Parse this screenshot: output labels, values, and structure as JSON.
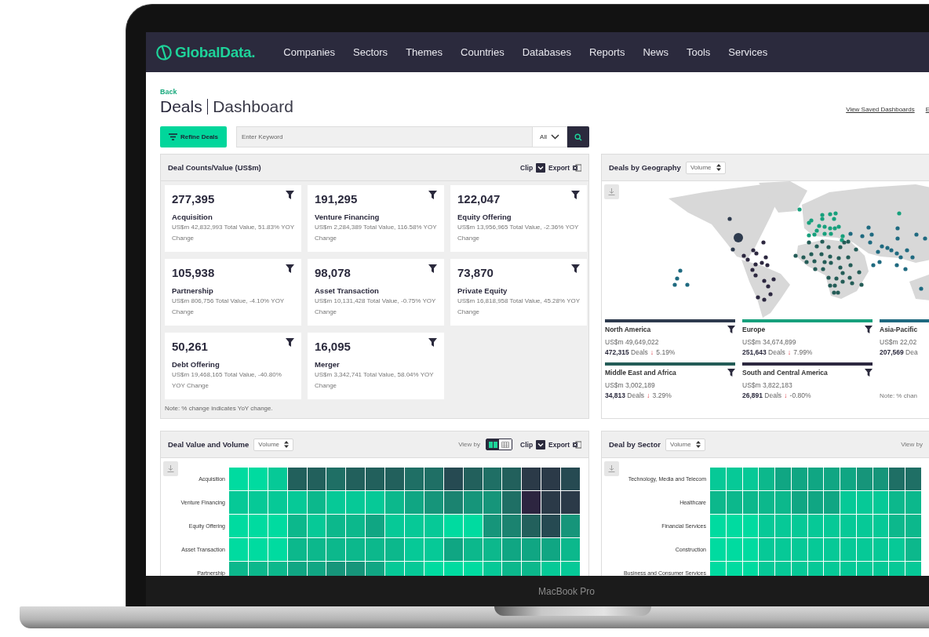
{
  "laptop": {
    "label": "MacBook Pro"
  },
  "nav": {
    "logo": "GlobalData.",
    "items": [
      "Companies",
      "Sectors",
      "Themes",
      "Countries",
      "Databases",
      "Reports",
      "News",
      "Tools",
      "Services"
    ]
  },
  "header": {
    "back": "Back",
    "title": "Deals",
    "subtitle": "Dashboard",
    "links": [
      "View Saved Dashboards",
      "E"
    ]
  },
  "toolbar": {
    "refine_button": "Refine Deals",
    "search": {
      "placeholder": "Enter Keyword"
    },
    "scope": "All"
  },
  "deal_counts": {
    "title": "Deal Counts/Value (US$m)",
    "clip": "Clip",
    "export": "Export",
    "cards": [
      {
        "count": "277,395",
        "type": "Acquisition",
        "detail": "US$m 42,832,993 Total Value, 51.83% YOY Change"
      },
      {
        "count": "191,295",
        "type": "Venture Financing",
        "detail": "US$m 2,284,389 Total Value, 116.58% YOY Change"
      },
      {
        "count": "122,047",
        "type": "Equity Offering",
        "detail": "US$m 13,956,965 Total Value, -2.36% YOY Change"
      },
      {
        "count": "105,938",
        "type": "Partnership",
        "detail": "US$m 806,756 Total Value, -4.10% YOY Change"
      },
      {
        "count": "98,078",
        "type": "Asset Transaction",
        "detail": "US$m 10,131,428 Total Value, -0.75% YOY Change"
      },
      {
        "count": "73,870",
        "type": "Private Equity",
        "detail": "US$m 16,818,958 Total Value, 45.28% YOY Change"
      },
      {
        "count": "50,261",
        "type": "Debt Offering",
        "detail": "US$m 19,468,165 Total Value, -40.80% YOY Change"
      },
      {
        "count": "16,095",
        "type": "Merger",
        "detail": "US$m 3,342,741 Total Value, 58.04% YOY Change"
      }
    ],
    "note": "Note: % change indicates YoY change."
  },
  "geography": {
    "title": "Deals by Geography",
    "selector": "Volume",
    "regions": [
      {
        "name": "North America",
        "color": "#2e3b4e",
        "filter": true,
        "value": "US$m 49,649,022",
        "deals": "**472,315** Deals",
        "arrow": "↓",
        "change": "5.19%"
      },
      {
        "name": "Europe",
        "color": "#17a07c",
        "filter": true,
        "value": "US$m 34,674,899",
        "deals": "**251,643** Deals",
        "arrow": "↓",
        "change": "7.99%"
      },
      {
        "name": "Asia-Pacific",
        "color": "#1f6a80",
        "filter": false,
        "value": "US$m 22,02",
        "deals": "**207,569** Dea"
      },
      {
        "name": "Middle East and Africa",
        "color": "#245c57",
        "filter": true,
        "value": "US$m 3,002,189",
        "deals": "**34,813** Deals",
        "arrow": "↓",
        "change": "3.29%"
      },
      {
        "name": "South and Central America",
        "color": "#2d2840",
        "filter": true,
        "value": "US$m 3,822,183",
        "deals": "**26,891** Deals",
        "arrow": "↓",
        "change": "-0.80%"
      }
    ],
    "note": "Note: % chan"
  },
  "value_volume": {
    "title": "Deal Value and Volume",
    "selector": "Volume",
    "view_by": "View by",
    "views": [
      {
        "kind": "heatmap",
        "selected": true
      },
      {
        "kind": "table",
        "selected": false
      }
    ],
    "clip": "Clip",
    "export": "Export",
    "rows": [
      "Acquisition",
      "Venture Financing",
      "Equity Offering",
      "Asset Transaction",
      "Partnership"
    ]
  },
  "sector": {
    "title": "Deal by Sector",
    "selector": "Volume",
    "view_by": "View by",
    "rows": [
      "Technology, Media and Telecom",
      "Healthcare",
      "Financial Services",
      "Construction",
      "Business and Consumer Services"
    ]
  }
}
